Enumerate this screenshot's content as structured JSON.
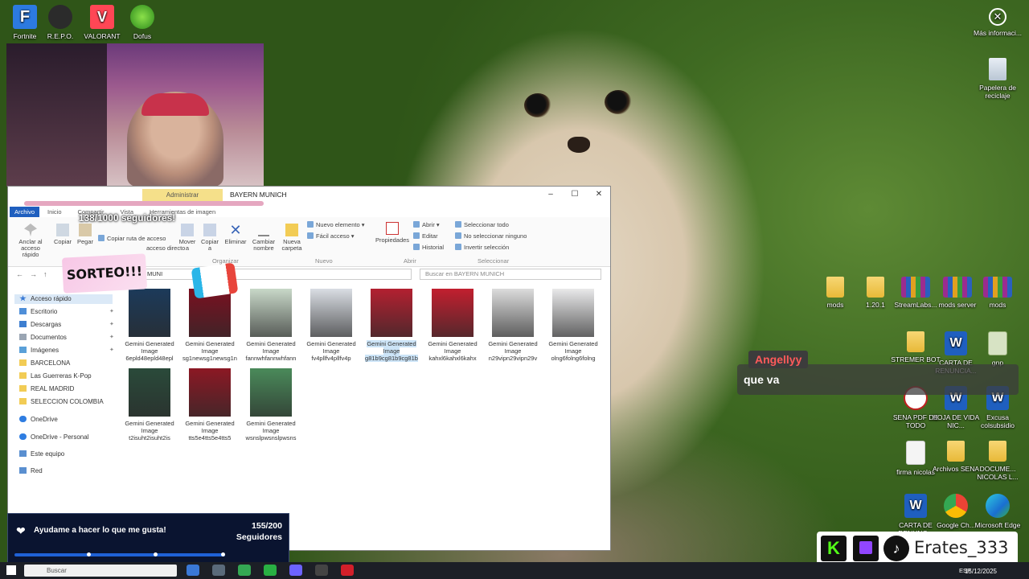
{
  "desktop": {
    "icons_left": [
      {
        "label": "Fortnite",
        "icon": "fortnite-icon"
      },
      {
        "label": "R.E.P.O.",
        "icon": "repo-icon"
      },
      {
        "label": "VALORANT",
        "icon": "valorant-icon"
      },
      {
        "label": "Dofus",
        "icon": "dofus-icon"
      }
    ],
    "icons_right_top": [
      {
        "label": "Más informaci...",
        "icon": "info-icon"
      },
      {
        "label": "Papelera de reciclaje",
        "icon": "recycle-bin-icon"
      }
    ],
    "icons_grid": [
      {
        "label": "mods",
        "icon": "folder-icon"
      },
      {
        "label": "1.20.1",
        "icon": "folder-icon"
      },
      {
        "label": "StreamLabs...",
        "icon": "winrar-icon"
      },
      {
        "label": "mods server",
        "icon": "winrar-icon"
      },
      {
        "label": "mods",
        "icon": "winrar-icon"
      },
      {
        "label": "STREMER BOT",
        "icon": "folder-icon"
      },
      {
        "label": "CARTA DE RENUNCIA...",
        "icon": "word-icon"
      },
      {
        "label": "gnp",
        "icon": "gnp-icon"
      },
      {
        "label": "SENA PDF DE TODO",
        "icon": "pdf-icon"
      },
      {
        "label": "HOJA DE VIDA NIC...",
        "icon": "word-icon"
      },
      {
        "label": "Excusa colsubsidio",
        "icon": "word-icon"
      },
      {
        "label": "firma nicolas",
        "icon": "image-icon"
      },
      {
        "label": "Archivos SENA",
        "icon": "folder-icon"
      },
      {
        "label": "DOCUME... NICOLAS L...",
        "icon": "folder-icon"
      },
      {
        "label": "CARTA DE RENUNC...",
        "icon": "word-icon"
      },
      {
        "label": "Google Ch...",
        "icon": "chrome-icon"
      },
      {
        "label": "Microsoft Edge",
        "icon": "edge-icon"
      }
    ]
  },
  "overlays": {
    "followers_badge": "138/1000 seguidores!",
    "sorteo": "SORTEO!!!",
    "chat": {
      "user": "Angellyy",
      "text": "que va"
    },
    "goal": {
      "message": "Ayudame a hacer lo que me gusta!",
      "count": "155/200",
      "count_label": "Seguidores",
      "progress": 0.775
    },
    "social_name": "Erates_333"
  },
  "explorer": {
    "title": "BAYERN MUNICH",
    "admin_tab": "Administrar",
    "window_buttons": {
      "minimize": "–",
      "maximize": "☐",
      "close": "✕"
    },
    "tabs": [
      "Archivo",
      "Inicio",
      "Compartir",
      "Vista",
      "Herramientas de imagen"
    ],
    "ribbon": {
      "anclar": "Anclar al acceso rápido",
      "copiar": "Copiar",
      "pegar": "Pegar",
      "copiar_ruta": "Copiar ruta de acceso",
      "pegar_acceso": "acceso directo",
      "mover": "Mover a",
      "copiar_a": "Copiar a",
      "eliminar": "Eliminar",
      "cambiar": "Cambiar nombre",
      "nueva_carpeta": "Nueva carpeta",
      "nuevo_elemento": "Nuevo elemento",
      "facil_acceso": "Fácil acceso",
      "propiedades": "Propiedades",
      "abrir": "Abrir",
      "editar": "Editar",
      "historial": "Historial",
      "seleccionar_todo": "Seleccionar todo",
      "no_seleccionar": "No seleccionar ninguno",
      "invertir": "Invertir selección",
      "groups": {
        "organizar": "Organizar",
        "nuevo": "Nuevo",
        "abrir": "Abrir",
        "seleccionar": "Seleccionar"
      }
    },
    "address": "MUNI",
    "search_placeholder": "Buscar en BAYERN MUNICH",
    "nav": [
      {
        "label": "Acceso rápido",
        "icon": "star-icon",
        "pinned": false
      },
      {
        "label": "Escritorio",
        "icon": "desktop-icon",
        "pinned": true
      },
      {
        "label": "Descargas",
        "icon": "download-icon",
        "pinned": true
      },
      {
        "label": "Documentos",
        "icon": "documents-icon",
        "pinned": true
      },
      {
        "label": "Imágenes",
        "icon": "pictures-icon",
        "pinned": true
      },
      {
        "label": "BARCELONA",
        "icon": "folder-icon",
        "pinned": false
      },
      {
        "label": "Las Guerreras K-Pop",
        "icon": "folder-icon",
        "pinned": false
      },
      {
        "label": "REAL MADRID",
        "icon": "folder-icon",
        "pinned": false
      },
      {
        "label": "SELECCION COLOMBIA",
        "icon": "folder-icon",
        "pinned": false
      },
      {
        "label": "OneDrive",
        "icon": "cloud-icon",
        "pinned": false
      },
      {
        "label": "OneDrive - Personal",
        "icon": "cloud-icon",
        "pinned": false
      },
      {
        "label": "Este equipo",
        "icon": "computer-icon",
        "pinned": false
      },
      {
        "label": "Red",
        "icon": "network-icon",
        "pinned": false
      }
    ],
    "files": [
      {
        "name": "Gemini Generated Image 6epld48epld48epl",
        "color": "#1c3a5a"
      },
      {
        "name": "Gemini Generated Image sg1newsg1newsg1n",
        "color": "#7a1020"
      },
      {
        "name": "Gemini Generated Image fannwhfannwhfann",
        "color": "#c8d8c8"
      },
      {
        "name": "Gemini Generated Image fv4pllfv4pllfv4p",
        "color": "#d9dde3"
      },
      {
        "name": "Gemini Generated Image g81b9cg81b9cg81b",
        "color": "#b32030"
      },
      {
        "name": "Gemini Generated Image kahxl6kahxl6kahx",
        "color": "#c21f2f"
      },
      {
        "name": "Gemini Generated Image n29vipn29vipn29v",
        "color": "#dcdcdc"
      },
      {
        "name": "Gemini Generated Image olng6folng6folng",
        "color": "#e9e9ea"
      },
      {
        "name": "Gemini Generated Image t2isuht2isuht2is",
        "color": "#2a4a3a"
      },
      {
        "name": "Gemini Generated Image tts5e4tts5e4tts5",
        "color": "#8c1824"
      },
      {
        "name": "Gemini Generated Image wsnslpwsnslpwsns",
        "color": "#4a8a5a"
      }
    ],
    "selected_file": 4
  },
  "taskbar": {
    "search_placeholder": "Buscar",
    "lang": "ESP",
    "date": "15/12/2025"
  }
}
